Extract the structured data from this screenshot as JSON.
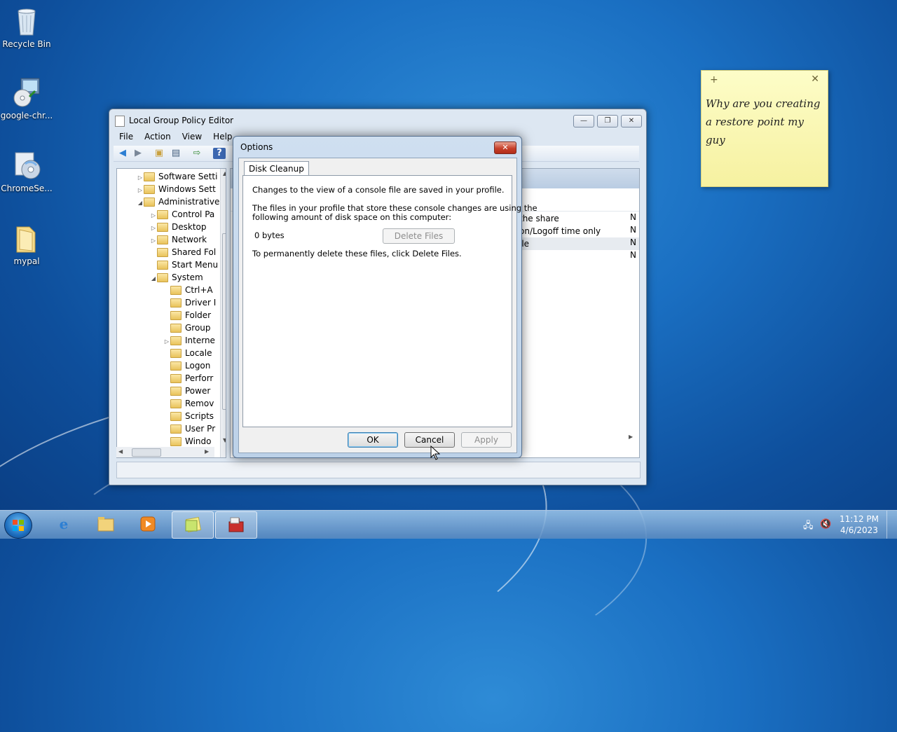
{
  "desktop": {
    "icons": [
      {
        "label": "Recycle Bin"
      },
      {
        "label": "google-chr..."
      },
      {
        "label": "ChromeSe..."
      },
      {
        "label": "mypal"
      }
    ]
  },
  "gpedit": {
    "title": "Local Group Policy Editor",
    "window_buttons": {
      "minimize": "—",
      "restore": "❐",
      "close": "✕"
    },
    "menu": [
      "File",
      "Action",
      "View",
      "Help"
    ],
    "tree": [
      "Software Setti",
      "Windows Sett",
      "Administrative",
      "Control Pa",
      "Desktop",
      "Network",
      "Shared Fol",
      "Start Menu",
      "System",
      "Ctrl+A",
      "Driver I",
      "Folder",
      "Group",
      "Interne",
      "Locale",
      "Logon",
      "Perforr",
      "Power",
      "Remov",
      "Scripts",
      "User Pr",
      "Windo"
    ],
    "right_rows": [
      {
        "text": "the share",
        "state": "N"
      },
      {
        "text": "on/Logoff time only",
        "state": "N"
      },
      {
        "text": "ile",
        "state": "N"
      },
      {
        "text": "",
        "state": "N"
      }
    ]
  },
  "options_dialog": {
    "title": "Options",
    "close": "✕",
    "tab": "Disk Cleanup",
    "line1": "Changes to the view of a console file are saved in your profile.",
    "line2a": "The files in your profile that store these console changes are using the",
    "line2b": "following amount of disk space on this computer:",
    "size": "0 bytes",
    "delete_files": "Delete Files",
    "line3": "To permanently delete these files, click Delete Files.",
    "ok": "OK",
    "cancel": "Cancel",
    "apply": "Apply"
  },
  "sticky_note": {
    "add": "+",
    "close": "✕",
    "text": "Why are you creating a restore point my guy"
  },
  "taskbar": {
    "time": "11:12 PM",
    "date": "4/6/2023"
  }
}
